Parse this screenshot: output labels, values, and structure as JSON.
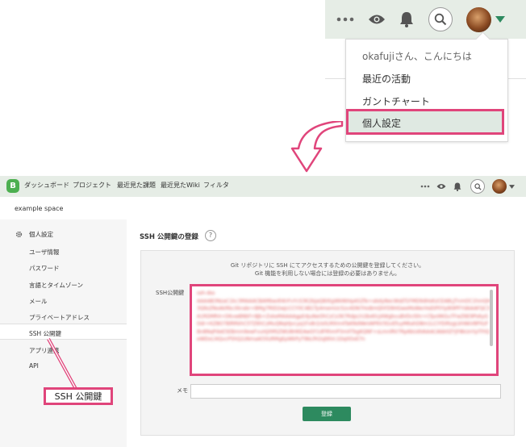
{
  "zoom_header": {
    "more_icon": "more-icon",
    "watch_icon": "eye-icon",
    "notification_icon": "bell-icon",
    "search_icon": "search-icon",
    "avatar": "avatar"
  },
  "zoom_dropdown": {
    "greeting": "okafujiさん、こんにちは",
    "items": [
      "最近の活動",
      "ガントチャート",
      "個人設定"
    ]
  },
  "app_header": {
    "nav": [
      "ダッシュボード",
      "プロジェクト",
      "最近見た課題",
      "最近見たWiki",
      "フィルタ"
    ]
  },
  "space_name": "example space",
  "sidebar": {
    "section_title": "個人設定",
    "items": [
      "ユーザ情報",
      "パスワード",
      "言語とタイムゾーン",
      "メール",
      "プライベートアドレス",
      "SSH 公開鍵",
      "アプリ連携",
      "API"
    ]
  },
  "main": {
    "title": "SSH 公開鍵の登録",
    "help": "?",
    "description_line1": "Git リポジトリに SSH にてアクセスするための公開鍵を登録してください。",
    "description_line2": "Git 機能を利用しない場合には登録の必要はありません。",
    "ssh_key_label": "SSH公開鍵",
    "key_header": "ssh-dss",
    "key_body": "AAAAB3NzaC1kc3MAAACBAMbw4hKrFvYcS3K2bJaQ8XtgWkNtHpA5Zfe+abdyNecWsEf1FMD9dHsKzCEA8LJTnmOC1hmQH3Q9zZNoAkRbcXkrabr+BMg7RtD2wJcCCY0C4B1Ty4memUc5zv4DN7HxBmQhFD9HGweMsWerHsEtP0YplK9PFYdAAAFQC3A1RDMR4+D6vwBNbf+8Jb+ZxkeMAAAAgpE4JuNeOhCzCs3K7RdpLh1BxKlcJ4WgbvuBVDcIShr+Cfpo9KGuTFwZ6E9Ps6yGDdr+KZ8O7BlRRkhC5TZ6hCzMuQNqHJvcyq1Fx8r2/s0LMXm4TaKNdWeVAP6V3GvEfuyM6ahD8m1LCiYDiRzgLkhNkV8PXzFBn8NqPdeE5EBmm9ewFvuHjXMSZWU8HKEAwGY1dFRhmP3mXTbgKQNF+sLmnlRV7Rp6bUdVAAACAbb0ZYjF8kUnYpTFtQeWDxLl4QvcP5hQ2zNmaAl3XzRMgEpWkPyT9bLfH2sJt6Vc1Dq0OxE7n",
    "memo_label": "メモ",
    "submit_label": "登録"
  },
  "callout_label": "SSH 公開鍵",
  "colors": {
    "header_bg": "#e6ede6",
    "highlight": "#e0457b",
    "brand_green": "#2d8a5f",
    "selected_bg": "#dfe9e2"
  }
}
